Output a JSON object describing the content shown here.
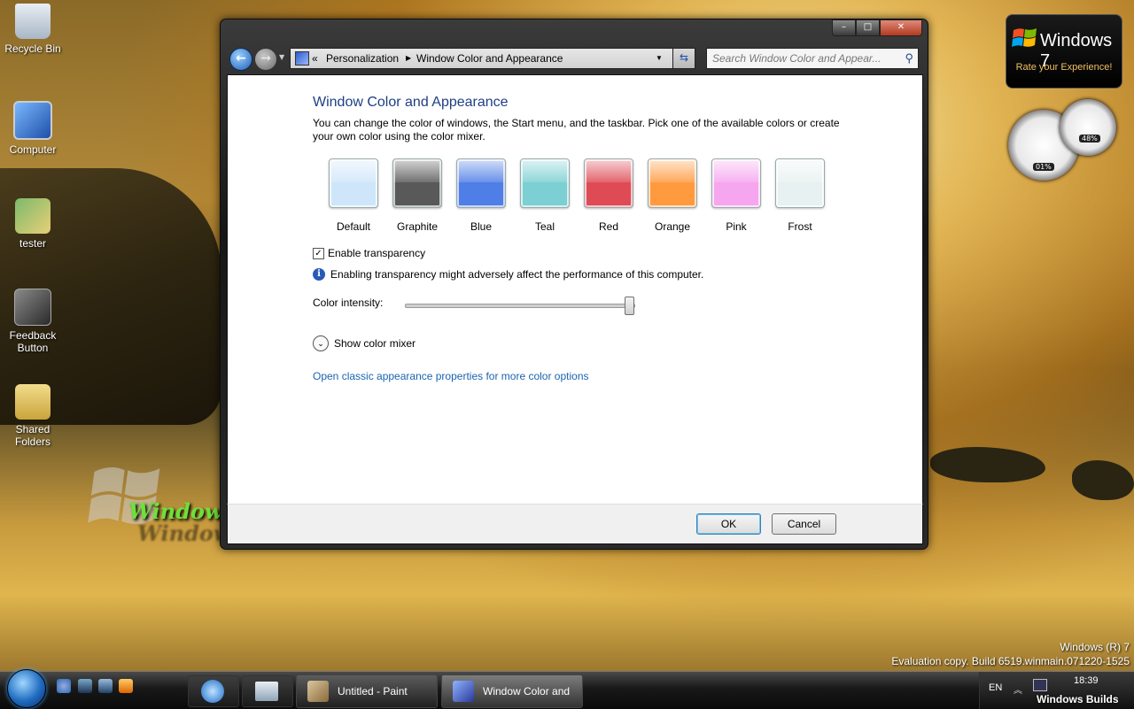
{
  "desktop": {
    "icons": [
      {
        "label": "Recycle Bin",
        "icon": "recycle-bin-icon"
      },
      {
        "label": "Computer",
        "icon": "computer-icon"
      },
      {
        "label": "tester",
        "icon": "user-folder-icon"
      },
      {
        "label": "Feedback Button",
        "icon": "feedback-shortcut-icon"
      },
      {
        "label": "Shared Folders",
        "icon": "shared-folders-icon"
      }
    ],
    "watermark": "Windows Build's",
    "eval_line1": "Windows (R) 7",
    "eval_line2": "Evaluation copy. Build 6519.winmain.071220-1525"
  },
  "gadgets": {
    "brand": "Windows 7",
    "rate": "Rate your Experience!",
    "cpu": "01%",
    "mem": "48%"
  },
  "window": {
    "breadcrumb_sep": "«",
    "breadcrumb": [
      "Personalization",
      "Window Color and Appearance"
    ],
    "search_placeholder": "Search Window Color and Appear...",
    "title": "Window Color and Appearance",
    "description": "You can change the color of windows, the Start menu, and the taskbar. Pick one of the available colors or create your own color using the color mixer.",
    "swatches": [
      {
        "label": "Default",
        "color": "#cfe6fa"
      },
      {
        "label": "Graphite",
        "color": "#595959"
      },
      {
        "label": "Blue",
        "color": "#4f7ee6"
      },
      {
        "label": "Teal",
        "color": "#7ccfd2"
      },
      {
        "label": "Red",
        "color": "#df4b55"
      },
      {
        "label": "Orange",
        "color": "#ff9a3f"
      },
      {
        "label": "Pink",
        "color": "#f6a6ee"
      },
      {
        "label": "Frost",
        "color": "#e8f1f1"
      }
    ],
    "transparency_label": "Enable transparency",
    "transparency_checked": true,
    "info_text": "Enabling transparency might adversely affect the performance of this computer.",
    "intensity_label": "Color intensity:",
    "intensity_value": 1.0,
    "mixer_label": "Show color mixer",
    "classic_link": "Open classic appearance properties for more color options",
    "ok": "OK",
    "cancel": "Cancel"
  },
  "taskbar": {
    "items": [
      {
        "label": "Untitled - Paint"
      },
      {
        "label": "Window Color and"
      }
    ],
    "lang": "EN",
    "clock": "18:39",
    "tray_brand": "Windows Builds"
  }
}
